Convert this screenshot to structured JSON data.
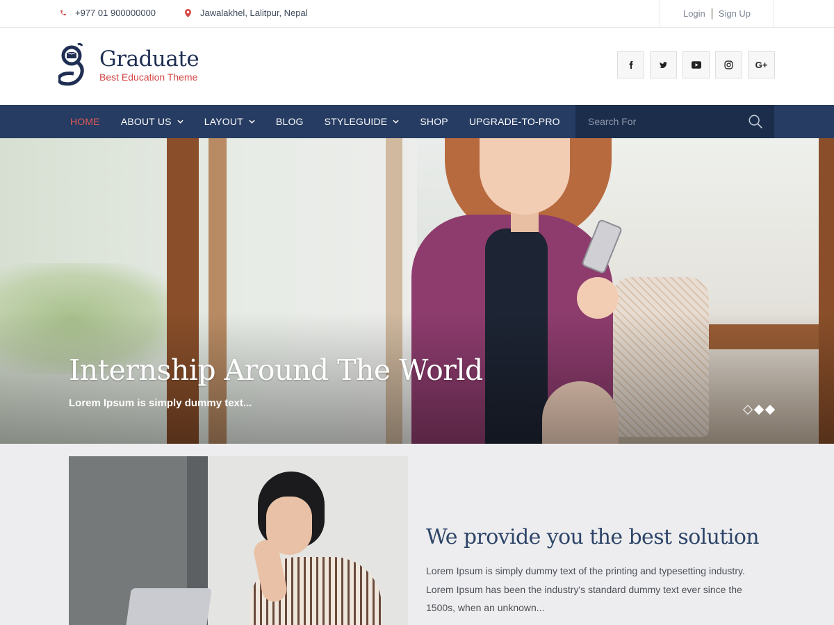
{
  "topbar": {
    "phone": "+977 01 900000000",
    "address": "Jawalakhel, Lalitpur, Nepal",
    "login": "Login",
    "signup": "Sign Up"
  },
  "header": {
    "brand": "Graduate",
    "tagline": "Best Education Theme",
    "socials": [
      {
        "icon": "facebook-icon",
        "glyph": "f"
      },
      {
        "icon": "twitter-icon",
        "glyph": "t"
      },
      {
        "icon": "youtube-icon",
        "glyph": "yt"
      },
      {
        "icon": "instagram-icon",
        "glyph": "ig"
      },
      {
        "icon": "google-plus-icon",
        "glyph": "G+"
      }
    ]
  },
  "nav": {
    "items": [
      {
        "label": "HOME",
        "active": true,
        "dropdown": false
      },
      {
        "label": "ABOUT US",
        "active": false,
        "dropdown": true
      },
      {
        "label": "LAYOUT",
        "active": false,
        "dropdown": true
      },
      {
        "label": "BLOG",
        "active": false,
        "dropdown": false
      },
      {
        "label": "STYLEGUIDE",
        "active": false,
        "dropdown": true
      },
      {
        "label": "SHOP",
        "active": false,
        "dropdown": false
      },
      {
        "label": "UPGRADE-TO-PRO",
        "active": false,
        "dropdown": false
      }
    ],
    "search_placeholder": "Search For"
  },
  "hero": {
    "title": "Internship Around The World",
    "subtitle": "Lorem Ipsum is simply dummy text...",
    "slides": 3,
    "active_slide": 1
  },
  "about": {
    "title": "We provide you the best solution",
    "text": "Lorem Ipsum is simply dummy text of the printing and typesetting industry. Lorem Ipsum has been the industry's standard dummy text ever since the 1500s, when an unknown..."
  },
  "colors": {
    "nav_bg": "#263c62",
    "accent": "#d64545",
    "brand_text": "#1f2f53"
  }
}
